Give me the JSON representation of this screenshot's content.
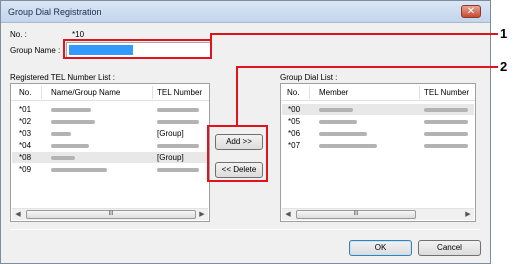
{
  "window": {
    "title": "Group Dial Registration",
    "close_label": "✕"
  },
  "fields": {
    "no_label": "No. :",
    "no_value": "*10",
    "group_name_label": "Group Name :"
  },
  "left_list": {
    "label": "Registered TEL Number List :",
    "columns": [
      "No.",
      "Name/Group Name",
      "TEL Number"
    ],
    "rows": [
      {
        "no": "*01",
        "tel": ""
      },
      {
        "no": "*02",
        "tel": ""
      },
      {
        "no": "*03",
        "tel": "[Group]"
      },
      {
        "no": "*04",
        "tel": ""
      },
      {
        "no": "*08",
        "tel": "[Group]"
      },
      {
        "no": "*09",
        "tel": ""
      }
    ],
    "scroll_thumb": "III"
  },
  "right_list": {
    "label": "Group Dial List :",
    "columns": [
      "No.",
      "Member",
      "TEL Number"
    ],
    "rows": [
      {
        "no": "*00"
      },
      {
        "no": "*05"
      },
      {
        "no": "*06"
      },
      {
        "no": "*07"
      }
    ],
    "scroll_thumb": "III"
  },
  "buttons": {
    "add": "Add >>",
    "delete": "<< Delete",
    "ok": "OK",
    "cancel": "Cancel"
  },
  "callouts": {
    "one": "1",
    "two": "2"
  },
  "colors": {
    "highlight": "#e0141c",
    "selection": "#3399ff"
  }
}
